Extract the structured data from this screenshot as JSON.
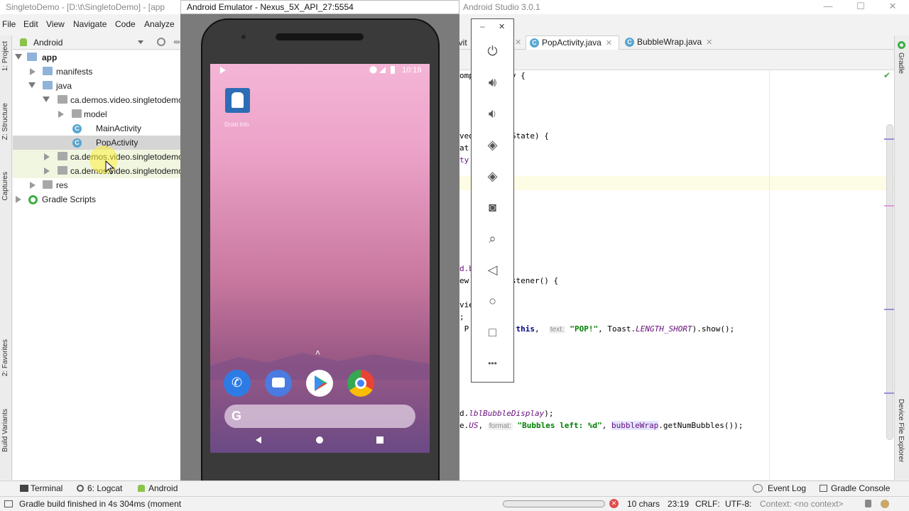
{
  "titlebar": {
    "left_title": "SingletoDemo - [D:\\t\\SingletoDemo] - [app",
    "right_title": "Android Studio 3.0.1",
    "minimize": "—",
    "maximize": "☐",
    "close": "✕"
  },
  "menu": {
    "file": "File",
    "edit": "Edit",
    "view": "View",
    "navigate": "Navigate",
    "code": "Code",
    "analyze": "Analyze"
  },
  "left_tool_tabs": {
    "project": "1: Project",
    "structure": "Z: Structure",
    "captures": "Captures",
    "favorites": "2: Favorites",
    "build_variants": "Build Variants"
  },
  "project_panel": {
    "view_selector": "Android",
    "tree": [
      {
        "label": "app",
        "bold": true
      },
      {
        "label": "manifests"
      },
      {
        "label": "java"
      },
      {
        "label": "ca.demos.video.singletodemo"
      },
      {
        "label": "model"
      },
      {
        "label": "MainActivity"
      },
      {
        "label": "PopActivity"
      },
      {
        "label": "ca.demos.video.singletodemo"
      },
      {
        "label": "ca.demos.video.singletodemo"
      },
      {
        "label": "res"
      },
      {
        "label": "Gradle Scripts"
      }
    ]
  },
  "emulator": {
    "window_title": "Android Emulator - Nexus_5X_API_27:5554",
    "status_time": "10:19",
    "app_icon_label": "Droid Info",
    "toolbar_icons": [
      "power-icon",
      "volume-up-icon",
      "volume-down-icon",
      "rotate-left-icon",
      "rotate-right-icon",
      "camera-icon",
      "zoom-icon",
      "back-icon",
      "home-icon",
      "overview-icon",
      "more-icon"
    ],
    "toolbar_minimize": "–",
    "toolbar_close": "✕",
    "more_glyph": "•••",
    "search_g": "G",
    "caret": "˄",
    "camera_glyph": "◙"
  },
  "editor": {
    "tabs": [
      {
        "label": "PopActivity.java",
        "active": true
      },
      {
        "label": "BubbleWrap.java",
        "active": false
      }
    ],
    "partial_tab_label": "ivit",
    "tab_close": "✕",
    "lines": {
      "l1": "omp        y {",
      "l2": "ved        State) {",
      "l3": "at",
      "l4": "ty",
      "l5": "d.b",
      "l6": "ew.       istener() {",
      "l7": "vie",
      "l8": ";",
      "l9_pre": " P        y.",
      "l9_this": "this",
      "l9_comma": ",",
      "l9_hint": "text:",
      "l9_str": "\"POP!\"",
      "l9_mid": ", Toast.",
      "l9_const": "LENGTH_SHORT",
      "l9_end": ").show();",
      "l10_pre": "d.",
      "l10_ital": "lblBubbleDisplay",
      "l10_end": ");",
      "l11_pre": "e.",
      "l11_ital": "US",
      "l11_comma": ",",
      "l11_hint": "format:",
      "l11_str": "\"Bubbles left: %d\"",
      "l11_comma2": ", ",
      "l11_hl": "bubbleWrap",
      "l11_end": ".getNumBubbles());"
    }
  },
  "right_tool_tabs": {
    "gradle": "Gradle",
    "device_file_explorer": "Device File Explorer"
  },
  "bottom_tabs": {
    "terminal": "Terminal",
    "logcat": "6: Logcat",
    "android": "Android",
    "event_log": "Event Log",
    "gradle_console": "Gradle Console"
  },
  "status": {
    "message": "Gradle build finished in 4s 304ms (moment",
    "chars": "10 chars",
    "position": "23:19",
    "line_sep": "CRLF:",
    "encoding": "UTF-8:",
    "context": "Context: <no context>"
  },
  "colors": {
    "accent": "#58a6cf",
    "gradle_green": "#3eae44",
    "selection": "#d5d5d5"
  }
}
